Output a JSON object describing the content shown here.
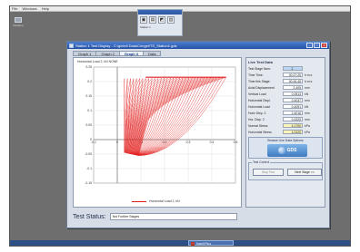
{
  "host": {
    "menu": [
      "File",
      "Windows",
      "Help"
    ],
    "side_icon": "computer-icon",
    "side_label": "Desktop"
  },
  "toolbar": {
    "buttons": [
      "save-icon",
      "print-icon",
      "graph-icon",
      "info-icon"
    ],
    "label": "Station 1"
  },
  "window": {
    "title": "Station 1 Test Display - C:\\gintell Data\\Cengel\\TS_Station1.gds",
    "tabs": [
      "Graph 1",
      "Graph 2",
      "Graph 3",
      "Data"
    ],
    "active_tab": "Graph 3"
  },
  "graph": {
    "title": "Horizontal Load 2, kN  NONE",
    "legend": "Horizontal Load 2, kN"
  },
  "data_panel": {
    "title": "Live Test Data",
    "rows": [
      {
        "label": "Test Stage Num:",
        "value": "2",
        "unit": "",
        "style": "blue"
      },
      {
        "label": "Time Time:",
        "value": "00:27:25",
        "unit": "h:m:s",
        "style": ""
      },
      {
        "label": "Time this Stage:",
        "value": "00:16:45",
        "unit": "h:m:s",
        "style": ""
      },
      {
        "label": "Axial Displacement",
        "value": "2.405",
        "unit": "mm",
        "style": ""
      },
      {
        "label": "Vertical Load",
        "value": "0.0513",
        "unit": "kN",
        "style": ""
      },
      {
        "label": "Horizontal Displ.",
        "value": "0.4037",
        "unit": "mm",
        "style": ""
      },
      {
        "label": "Horizontal Load",
        "value": "0.4051",
        "unit": "kN",
        "style": ""
      },
      {
        "label": "Horiz Disp. 2",
        "value": "2.4016",
        "unit": "mm",
        "style": ""
      },
      {
        "label": "Hor. Disp. 2",
        "value": "0.4325",
        "unit": "mm",
        "style": ""
      },
      {
        "label": "Normal Stress",
        "value": "4.1700",
        "unit": "kPa",
        "style": "hl"
      },
      {
        "label": "Horizontal Stress",
        "value": "1.0120",
        "unit": "kPa",
        "style": "hl"
      }
    ],
    "browse_label": "Browse Live Data Options",
    "logo_text": "GDS",
    "test_control_label": "Test Control",
    "stop_button": "Stop Test",
    "next_button": "Next Stage >>"
  },
  "status": {
    "label": "Test Status:",
    "value": "Not Further Stages"
  },
  "taskbar": {
    "item": "Kamil Plus"
  },
  "chart_data": {
    "type": "line",
    "title": "Horizontal Load 2, kN  NONE",
    "xlabel": "",
    "ylabel": "",
    "x_ticks": [
      "-0.1",
      "0",
      "0.1",
      "0.2",
      "0.3",
      "0.4",
      "0.5"
    ],
    "y_ticks": [
      "0.25",
      "0.2",
      "0.15",
      "0.1",
      "0.05",
      "0",
      "-0.05",
      "-0.1",
      "-0.15"
    ],
    "xlim": [
      -0.1,
      0.5
    ],
    "ylim": [
      -0.15,
      0.25
    ],
    "grid": true,
    "series": [
      {
        "name": "Horizontal Load 2, kN",
        "color": "#e21b1b"
      }
    ]
  }
}
